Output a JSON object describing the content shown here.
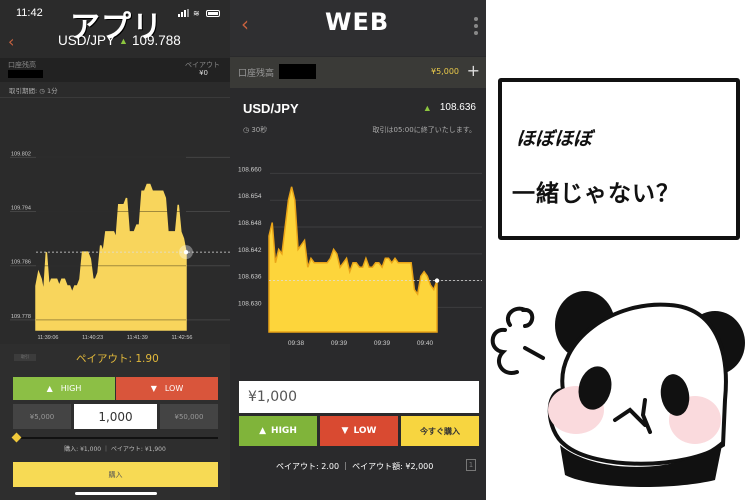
{
  "app": {
    "overlay_title": "アプリ",
    "status_time": "11:42",
    "pair": "USD/JPY",
    "rate": "109.788",
    "account_label": "口座残高",
    "payout_label": "ペイアウト",
    "payout_value": "¥0",
    "period": "取引期間: ◷ 1分",
    "mini_tag": "取引",
    "payout_rate": "ペイアウト: 1.90",
    "high_label": "HIGH",
    "low_label": "LOW",
    "preset_left": "¥5,000",
    "amount": "1,000",
    "preset_right": "¥50,000",
    "summary": "購入: ¥1,000 ｜ ペイアウト: ¥1,900",
    "buy_label": "購入",
    "slider_fraction": 0.0,
    "colors": {
      "high": "#8cbf45",
      "low": "#d9553b",
      "buy": "#f7da54",
      "accent": "#e2b93b"
    }
  },
  "web": {
    "overlay_title": "WEB",
    "account_label": "口座残高",
    "balance": "¥5,000",
    "plus": "+",
    "pair": "USD/JPY",
    "rate": "108.636",
    "duration": "◷ 30秒",
    "end_note": "取引は05:00に終了いたします。",
    "amount": "¥1,000",
    "high_label": "HIGH",
    "low_label": "LOW",
    "buy_now_label": "今すぐ購入",
    "summary": "ペイアウト: 2.00 ｜ ペイアウト額: ¥2,000",
    "oneclick": "1",
    "colors": {
      "high": "#80b43a",
      "low": "#d94a31",
      "buy": "#f7d540",
      "balance": "#e9c94a"
    }
  },
  "comment": {
    "line1": "ほぼほぼ",
    "line2": "一緒じゃない？"
  },
  "chart_data": [
    {
      "type": "area",
      "name": "app-chart",
      "title": "",
      "xlabel": "",
      "ylabel": "",
      "x_ticks": [
        "11:39:06",
        "11:40:23",
        "11:41:39",
        "11:42:56"
      ],
      "y_ticks": [
        109.778,
        109.786,
        109.794,
        109.802
      ],
      "ylim": [
        109.7765,
        109.809
      ],
      "current": 109.788,
      "values": [
        109.783,
        109.785,
        109.784,
        109.782,
        109.788,
        109.783,
        109.784,
        109.784,
        109.784,
        109.783,
        109.784,
        109.784,
        109.783,
        109.783,
        109.782,
        109.783,
        109.783,
        109.784,
        109.788,
        109.788,
        109.788,
        109.787,
        109.784,
        109.784,
        109.785,
        109.789,
        109.788,
        109.791,
        109.791,
        109.791,
        109.791,
        109.79,
        109.795,
        109.795,
        109.795,
        109.796,
        109.791,
        109.791,
        109.791,
        109.792,
        109.792,
        109.797,
        109.797,
        109.798,
        109.798,
        109.797,
        109.797,
        109.797,
        109.797,
        109.797,
        109.796,
        109.791,
        109.791,
        109.791,
        109.791,
        109.795,
        109.791,
        109.79,
        109.788
      ],
      "grid": true
    },
    {
      "type": "area",
      "name": "web-chart",
      "title": "",
      "xlabel": "",
      "ylabel": "",
      "x_ticks": [
        "09:38",
        "09:39",
        "09:39",
        "09:40"
      ],
      "y_ticks": [
        108.63,
        108.636,
        108.642,
        108.648,
        108.654,
        108.66
      ],
      "ylim": [
        108.6245,
        108.663
      ],
      "current": 108.636,
      "values": [
        108.646,
        108.649,
        108.64,
        108.643,
        108.642,
        108.648,
        108.654,
        108.657,
        108.654,
        108.643,
        108.644,
        108.645,
        108.639,
        108.641,
        108.64,
        108.64,
        108.64,
        108.64,
        108.64,
        108.641,
        108.643,
        108.642,
        108.639,
        108.64,
        108.641,
        108.638,
        108.64,
        108.64,
        108.639,
        108.639,
        108.641,
        108.639,
        108.639,
        108.64,
        108.64,
        108.639,
        108.641,
        108.641,
        108.64,
        108.641,
        108.64,
        108.64,
        108.64,
        108.64,
        108.64,
        108.634,
        108.633,
        108.637,
        108.638,
        108.637,
        108.635,
        108.634,
        108.636
      ],
      "grid": true
    }
  ]
}
